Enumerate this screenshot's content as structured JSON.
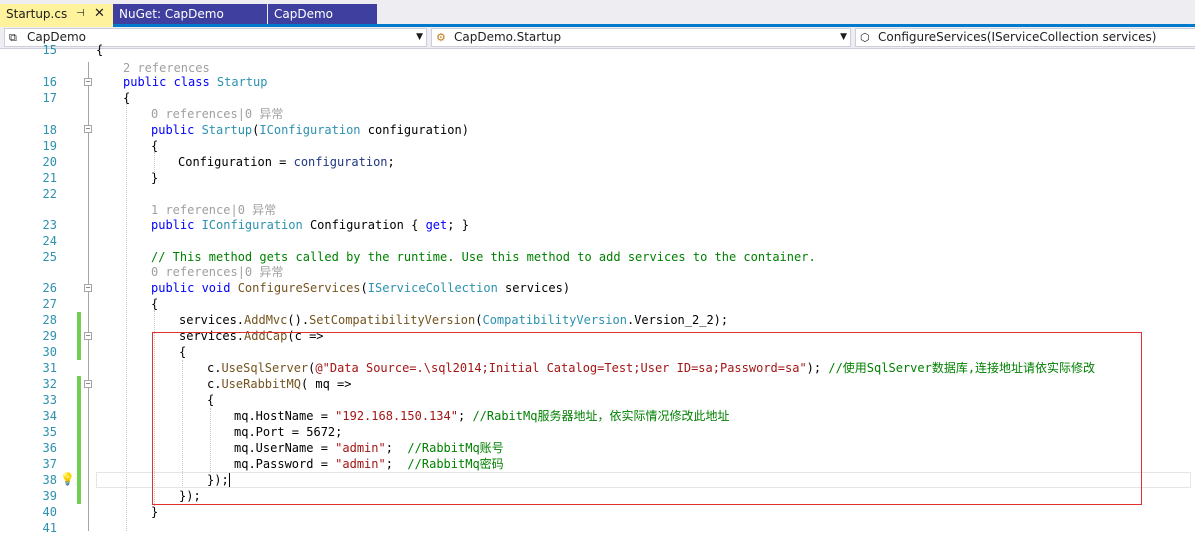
{
  "tabs": [
    {
      "label": "Startup.cs",
      "pin": "⊣",
      "close": "✕"
    },
    {
      "label": "NuGet: CapDemo"
    },
    {
      "label": "CapDemo"
    }
  ],
  "nav": {
    "project": {
      "icon": "project-icon",
      "label": "CapDemo"
    },
    "type": {
      "icon": "class-icon",
      "label": "CapDemo.Startup"
    },
    "member": {
      "icon": "method-icon",
      "label": "ConfigureServices(IServiceCollection services)"
    }
  },
  "codelens": {
    "r15": "2 references",
    "r17": "0 references|0 异常",
    "r22": "1 reference|0 异常",
    "r25": "0 references|0 异常"
  },
  "lines": {
    "n15": "15",
    "n16": "16",
    "n17": "17",
    "n18": "18",
    "n19": "19",
    "n20": "20",
    "n21": "21",
    "n22": "22",
    "n23": "23",
    "n24": "24",
    "n25": "25",
    "n26": "26",
    "n27": "27",
    "n28": "28",
    "n29": "29",
    "n30": "30",
    "n31": "31",
    "n32": "32",
    "n33": "33",
    "n34": "34",
    "n35": "35",
    "n36": "36",
    "n37": "37",
    "n38": "38",
    "n39": "39",
    "n40": "40",
    "n41": "41"
  },
  "code": {
    "l15": "{",
    "l16_kw": "public class ",
    "l16_ty": "Startup",
    "l17": "{",
    "l18_kw": "public ",
    "l18_ty": "Startup",
    "l18_a": "(",
    "l18_ty2": "IConfiguration",
    "l18_b": " configuration)",
    "l19": "{",
    "l20_a": "Configuration = ",
    "l20_b": "configuration",
    "l20_c": ";",
    "l21": "}",
    "l23_kw": "public ",
    "l23_ty": "IConfiguration",
    "l23_a": " Configuration { ",
    "l23_kw2": "get",
    "l23_b": "; }",
    "l25_cm": "// This method gets called by the runtime. Use this method to add services to the container.",
    "l26_kw": "public void ",
    "l26_mt": "ConfigureServices",
    "l26_a": "(",
    "l26_ty": "IServiceCollection",
    "l26_b": " services)",
    "l27": "{",
    "l28_a": "services.",
    "l28_mt": "AddMvc",
    "l28_b": "().",
    "l28_mt2": "SetCompatibilityVersion",
    "l28_c": "(",
    "l28_ty": "CompatibilityVersion",
    "l28_d": ".Version_2_2);",
    "l29_a": "services.",
    "l29_mt": "AddCap",
    "l29_b": "(c =>",
    "l30": "{",
    "l31_a": "c.",
    "l31_mt": "UseSqlServer",
    "l31_b": "(",
    "l31_st": "@\"Data Source=.\\sql2014;Initial Catalog=Test;User ID=sa;Password=sa\"",
    "l31_c": "); ",
    "l31_cm": "//使用SqlServer数据库,连接地址请依实际修改",
    "l32_a": "c.",
    "l32_mt": "UseRabbitMQ",
    "l32_b": "( mq =>",
    "l33": "{",
    "l34_a": "mq.HostName = ",
    "l34_st": "\"192.168.150.134\"",
    "l34_b": "; ",
    "l34_cm": "//RabitMq服务器地址，依实际情况修改此地址",
    "l35": "mq.Port = 5672;",
    "l36_a": "mq.UserName = ",
    "l36_st": "\"admin\"",
    "l36_b": ";  ",
    "l36_cm": "//RabbitMq账号",
    "l37_a": "mq.Password = ",
    "l37_st": "\"admin\"",
    "l37_b": ";  ",
    "l37_cm": "//RabbitMq密码",
    "l38": "});",
    "l39": "});",
    "l40": "}"
  }
}
